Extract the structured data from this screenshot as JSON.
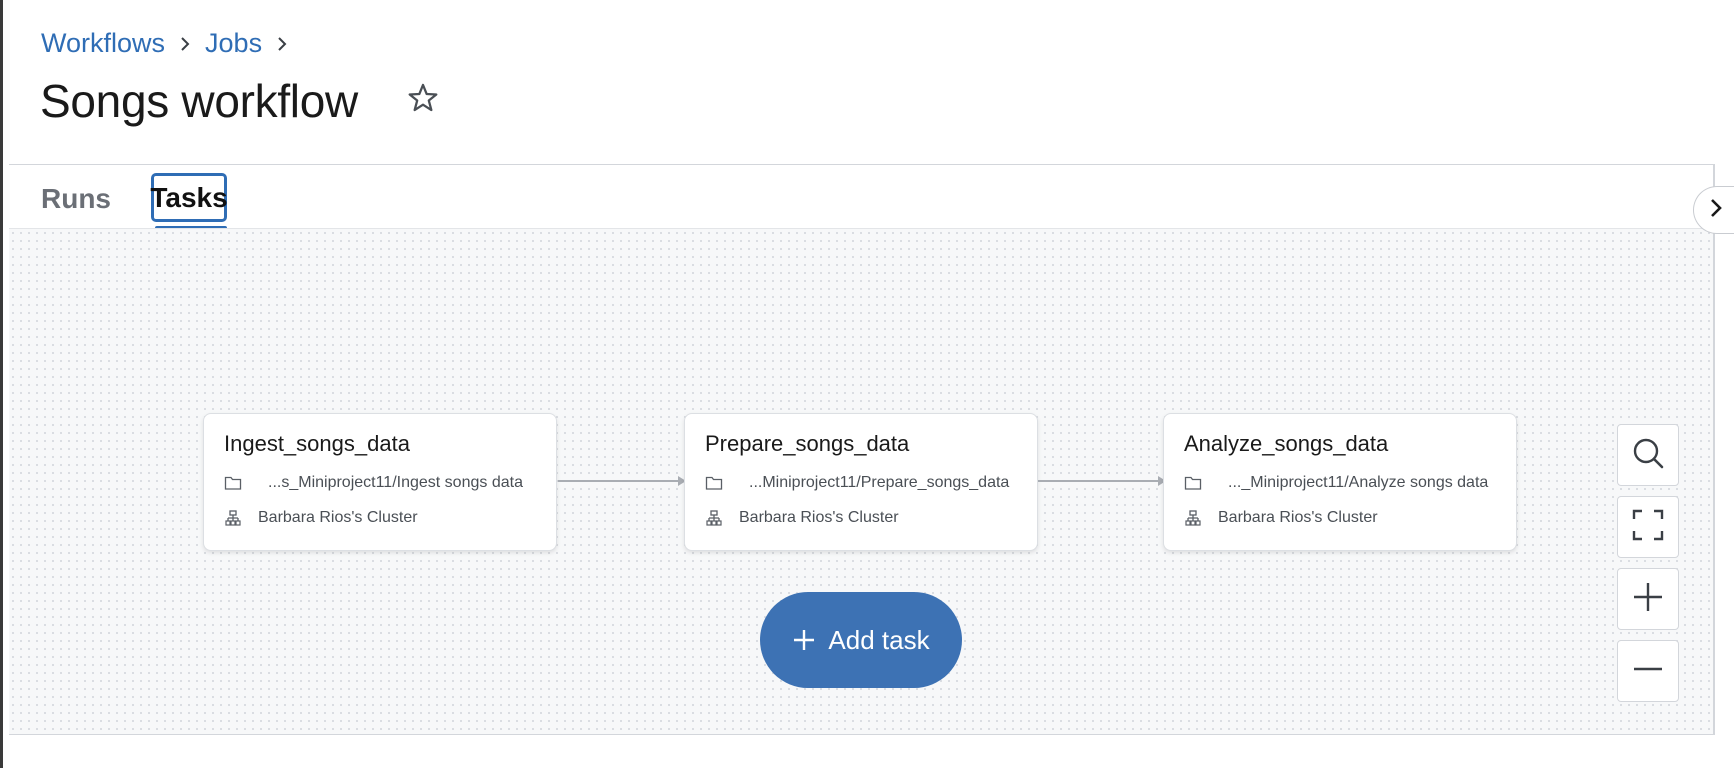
{
  "breadcrumb": {
    "items": [
      "Workflows",
      "Jobs"
    ]
  },
  "page": {
    "title": "Songs workflow"
  },
  "tabs": {
    "runs": "Runs",
    "tasks": "Tasks",
    "active": "Tasks"
  },
  "tasks": [
    {
      "name": "Ingest_songs_data",
      "path": "...s_Miniproject11/Ingest songs data",
      "cluster": "Barbara Rios's Cluster"
    },
    {
      "name": "Prepare_songs_data",
      "path": "...Miniproject11/Prepare_songs_data",
      "cluster": "Barbara Rios's Cluster"
    },
    {
      "name": "Analyze_songs_data",
      "path": "..._Miniproject11/Analyze songs data",
      "cluster": "Barbara Rios's Cluster"
    }
  ],
  "add_task": {
    "label": "Add task"
  },
  "icons": {
    "chevron": "chevron-right-icon",
    "star": "star-outline-icon",
    "folder": "folder-icon",
    "cluster": "cluster-icon",
    "search": "search-icon",
    "fit": "fit-to-screen-icon",
    "zoom_in": "plus-icon",
    "zoom_out": "minus-icon",
    "panel_toggle": "chevron-right-icon"
  },
  "colors": {
    "accent": "#3d72b4",
    "link": "#2f6db5"
  }
}
